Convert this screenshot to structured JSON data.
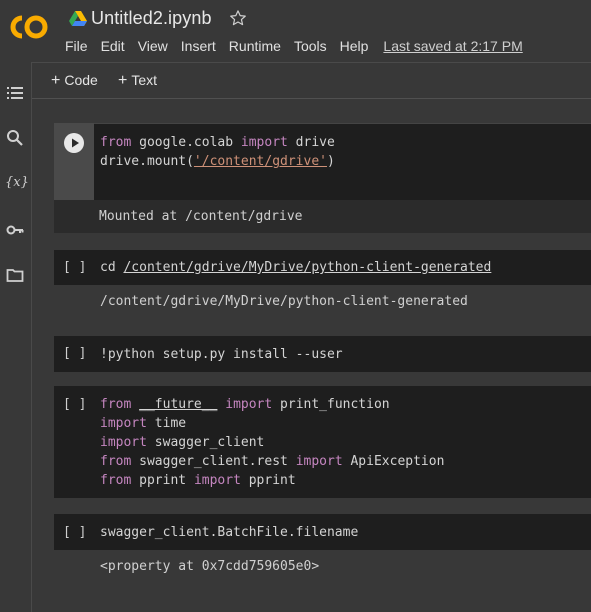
{
  "header": {
    "title": "Untitled2.ipynb",
    "menu": [
      "File",
      "Edit",
      "View",
      "Insert",
      "Runtime",
      "Tools",
      "Help"
    ],
    "last_saved": "Last saved at 2:17 PM"
  },
  "toolbar": {
    "code_label": "Code",
    "text_label": "Text"
  },
  "rail": {
    "icons": [
      "table-of-contents-icon",
      "search-icon",
      "variables-icon",
      "secrets-key-icon",
      "files-folder-icon"
    ],
    "variables_glyph": "{x}"
  },
  "cells": [
    {
      "prompt": "",
      "lines": [
        [
          "from",
          " google.colab ",
          "import",
          " drive"
        ],
        [
          "drive.mount(",
          "'/content/gdrive'",
          ")"
        ]
      ],
      "output": "Mounted at /content/gdrive"
    },
    {
      "prompt": "[ ]",
      "lines": [
        [
          "cd ",
          "/content/gdrive/MyDrive/python-client-generated"
        ]
      ],
      "output": "/content/gdrive/MyDrive/python-client-generated"
    },
    {
      "prompt": "[ ]",
      "lines": [
        [
          "!python setup.py install --user"
        ]
      ],
      "output": ""
    },
    {
      "prompt": "[ ]",
      "lines": [
        [
          "from",
          " ",
          "__future__",
          " ",
          "import",
          " print_function"
        ],
        [
          "import",
          " time"
        ],
        [
          "import",
          " swagger_client"
        ],
        [
          "from",
          " swagger_client.rest ",
          "import",
          " ApiException"
        ],
        [
          "from",
          " pprint ",
          "import",
          " pprint"
        ]
      ],
      "output": ""
    },
    {
      "prompt": "[ ]",
      "lines": [
        [
          "swagger_client.BatchFile.filename"
        ]
      ],
      "output": "<property at 0x7cdd759605e0>"
    }
  ],
  "colors": {
    "background": "#383838",
    "cell_background": "#2b2b2b",
    "keyword": "#c586c0",
    "string": "#ce9178",
    "logo_orange": "#f9ab00"
  }
}
